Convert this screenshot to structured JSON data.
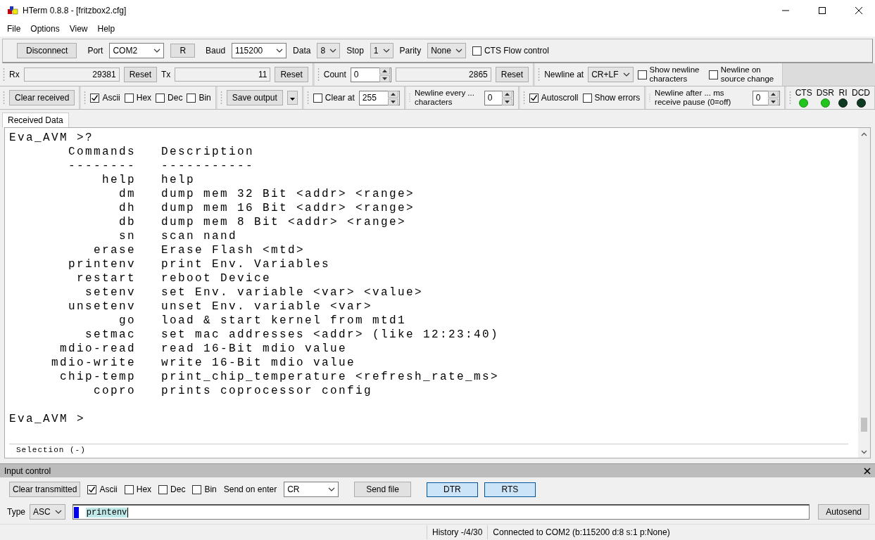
{
  "window": {
    "title": "HTerm 0.8.8 - [fritzbox2.cfg]"
  },
  "menu": [
    "File",
    "Options",
    "View",
    "Help"
  ],
  "connection": [
    {
      "kind": "button",
      "label": "Disconnect"
    },
    {
      "kind": "combo",
      "label": "Port",
      "value": "COM2",
      "wide": true
    },
    {
      "kind": "small-button",
      "label": "R"
    },
    {
      "kind": "combo",
      "label": "Baud",
      "value": "115200",
      "wide": true
    },
    {
      "kind": "combo",
      "label": "Data",
      "value": "8"
    },
    {
      "kind": "combo",
      "label": "Stop",
      "value": "1"
    },
    {
      "kind": "combo",
      "label": "Parity",
      "value": "None"
    },
    {
      "kind": "check",
      "label": "CTS Flow control",
      "checked": false
    }
  ],
  "toolbar_rows": [
    [
      [
        {
          "kind": "label",
          "label": "Rx"
        },
        {
          "kind": "counter",
          "value": "29381"
        },
        {
          "kind": "button",
          "label": "Reset"
        },
        {
          "kind": "label",
          "label": "Tx"
        },
        {
          "kind": "counter",
          "value": "11"
        },
        {
          "kind": "button",
          "label": "Reset"
        }
      ],
      [
        {
          "kind": "label",
          "label": "Count"
        },
        {
          "kind": "spin",
          "value": "0"
        },
        {
          "kind": "counter",
          "value": "2865"
        },
        {
          "kind": "button",
          "label": "Reset"
        }
      ],
      [
        {
          "kind": "label",
          "label": "Newline at"
        },
        {
          "kind": "combo",
          "value": "CR+LF"
        },
        {
          "kind": "check",
          "label": "Show newline characters",
          "checked": false
        },
        {
          "kind": "check",
          "label": "Newline on source change",
          "checked": false
        }
      ]
    ],
    [
      [
        {
          "kind": "button",
          "label": "Clear received"
        }
      ],
      [
        {
          "kind": "check",
          "label": "Ascii",
          "checked": true
        },
        {
          "kind": "check",
          "label": "Hex",
          "checked": false
        },
        {
          "kind": "check",
          "label": "Dec",
          "checked": false
        },
        {
          "kind": "check",
          "label": "Bin",
          "checked": false
        }
      ],
      [
        {
          "kind": "split-button",
          "label": "Save output"
        }
      ],
      [
        {
          "kind": "check",
          "label": "Clear at",
          "checked": false
        },
        {
          "kind": "spin",
          "value": "255"
        }
      ],
      [
        {
          "kind": "note",
          "label": "Newline every ... characters"
        },
        {
          "kind": "spin",
          "value": "0"
        }
      ],
      [
        {
          "kind": "check",
          "label": "Autoscroll",
          "checked": true
        },
        {
          "kind": "check",
          "label": "Show errors",
          "checked": false
        }
      ],
      [
        {
          "kind": "note",
          "label": "Newline after ... ms receive pause (0=off)"
        },
        {
          "kind": "spin",
          "value": "0"
        }
      ],
      [
        {
          "kind": "led",
          "label": "CTS",
          "on": true
        },
        {
          "kind": "led",
          "label": "DSR",
          "on": true
        },
        {
          "kind": "led",
          "label": "RI",
          "on": false
        },
        {
          "kind": "led",
          "label": "DCD",
          "on": false
        }
      ]
    ]
  ],
  "received": {
    "tab": {
      "label": "Received Data",
      "selected": true
    },
    "blocks": [
      [
        "Eva_AVM >?",
        "       Commands   Description",
        "       --------   -----------",
        "           help   help",
        "             dm   dump mem 32 Bit <addr> <range>",
        "             dh   dump mem 16 Bit <addr> <range>",
        "             db   dump mem 8 Bit <addr> <range>",
        "             sn   scan nand",
        "          erase   Erase Flash <mtd>",
        "       printenv   print Env. Variables",
        "        restart   reboot Device",
        "         setenv   set Env. variable <var> <value>",
        "       unsetenv   unset Env. variable <var>",
        "             go   load & start kernel from mtd1",
        "         setmac   set mac addresses <addr> (like 12:23:40)",
        "      mdio-read   read 16-Bit mdio value",
        "     mdio-write   write 16-Bit mdio value",
        "      chip-temp   print_chip_temperature <refresh_rate_ms>",
        "          copro   prints coprocessor config"
      ],
      [
        "Eva_AVM >"
      ]
    ],
    "selection": "Selection (-)"
  },
  "input_control": {
    "title": "Input control",
    "row": [
      {
        "kind": "button",
        "label": "Clear transmitted"
      },
      {
        "kind": "check",
        "label": "Ascii",
        "checked": true
      },
      {
        "kind": "check",
        "label": "Hex",
        "checked": false
      },
      {
        "kind": "check",
        "label": "Dec",
        "checked": false
      },
      {
        "kind": "check",
        "label": "Bin",
        "checked": false
      },
      {
        "kind": "label",
        "label": "Send on enter"
      },
      {
        "kind": "combo",
        "value": "CR",
        "wide": true
      },
      {
        "kind": "wide-button",
        "label": "Send file"
      },
      {
        "kind": "toggle",
        "label": "DTR",
        "on": true
      },
      {
        "kind": "toggle",
        "label": "RTS",
        "on": true
      }
    ],
    "type": {
      "label": "Type",
      "value": "ASC"
    },
    "input": {
      "value": "printenv",
      "value_selected": true
    },
    "autosend": "Autosend"
  },
  "status_bar": [
    "History -/4/30",
    "Connected to COM2 (b:115200 d:8 s:1 p:None)"
  ]
}
